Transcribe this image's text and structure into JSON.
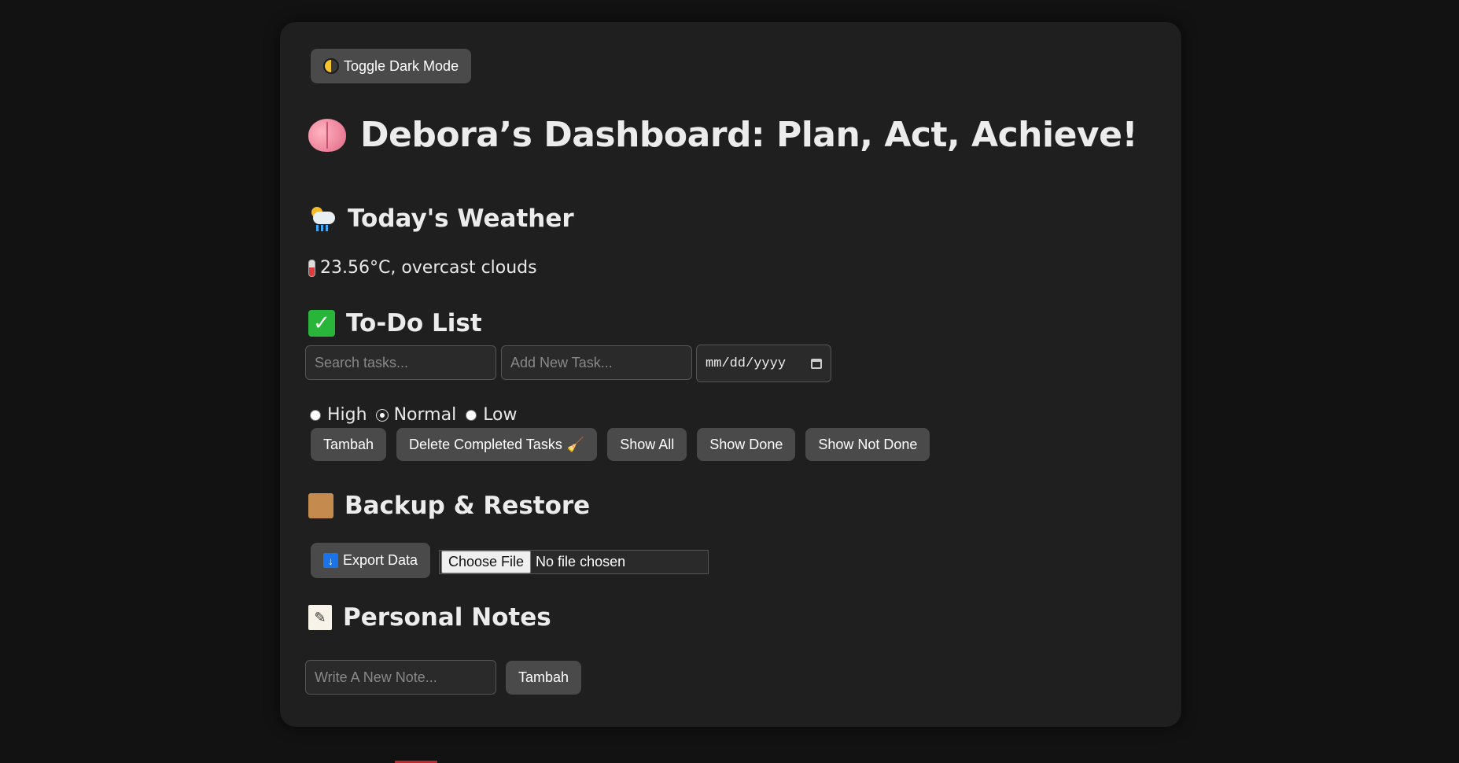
{
  "toolbar": {
    "toggle_label": "Toggle Dark Mode"
  },
  "page": {
    "title": "Debora’s Dashboard: Plan, Act, Achieve!"
  },
  "weather": {
    "heading": "Today's Weather",
    "summary": "23.56°C, overcast clouds"
  },
  "todo": {
    "heading": "To-Do List",
    "search_placeholder": "Search tasks...",
    "new_task_placeholder": "Add New Task...",
    "date_placeholder": "mm/dd/yyyy",
    "priorities": [
      {
        "label": "High",
        "checked": false
      },
      {
        "label": "Normal",
        "checked": true
      },
      {
        "label": "Low",
        "checked": false
      }
    ],
    "buttons": {
      "add": "Tambah",
      "delete_completed": "Delete Completed Tasks",
      "show_all": "Show All",
      "show_done": "Show Done",
      "show_not_done": "Show Not Done"
    }
  },
  "backup": {
    "heading": "Backup & Restore",
    "export_label": "Export Data",
    "choose_file_label": "Choose File",
    "file_status": "No file chosen"
  },
  "notes": {
    "heading": "Personal Notes",
    "note_placeholder": "Write A New Note...",
    "add_label": "Tambah"
  },
  "icons": {
    "toggle": "half-moon-icon",
    "title": "brain-icon",
    "weather": "cloud-sun-rain-icon",
    "temperature": "thermometer-icon",
    "todo": "check-mark-icon",
    "delete": "broom-icon",
    "backup": "package-icon",
    "export": "download-arrow-icon",
    "notes": "memo-icon"
  },
  "colors": {
    "background": "#121212",
    "card": "#1f1f1f",
    "button": "#4a4a4a",
    "check_green": "#28b53a"
  }
}
